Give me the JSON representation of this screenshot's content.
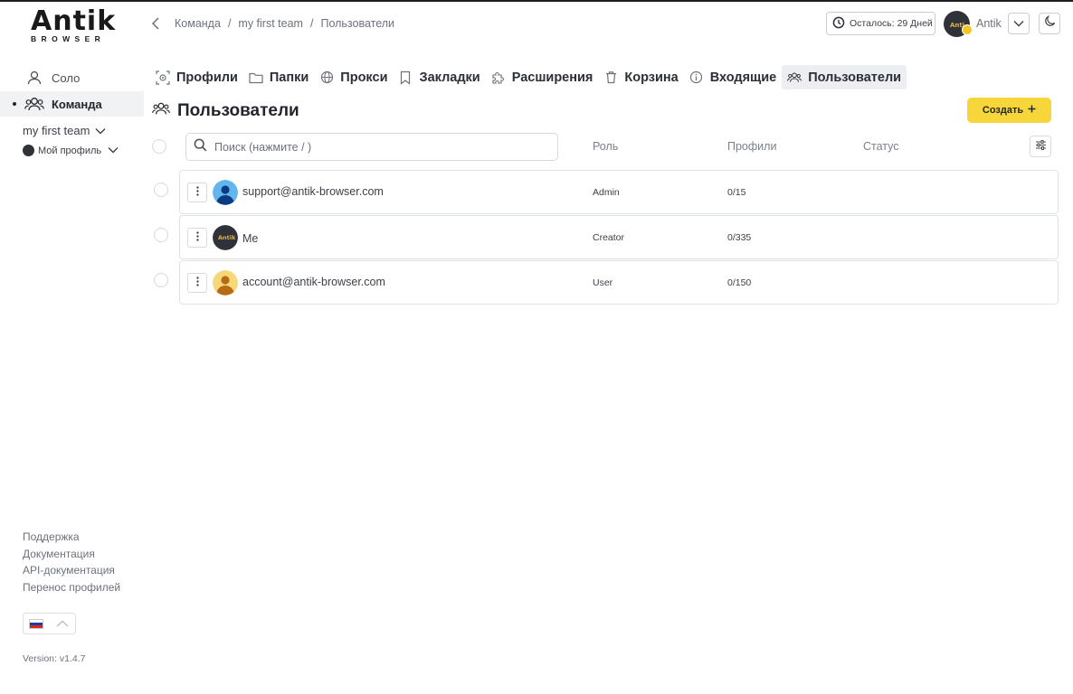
{
  "brand": {
    "name": "Antik",
    "sub": "BROWSER"
  },
  "sidebar": {
    "items": [
      {
        "label": "Соло",
        "icon": "user-icon"
      },
      {
        "label": "Команда",
        "icon": "team-icon"
      }
    ],
    "team_select": "my first team",
    "profile_select": "Мой профиль",
    "footer_links": [
      "Поддержка",
      "Документация",
      "API-документация",
      "Перенос профилей"
    ],
    "language": "ru",
    "version": "Version: v1.4.7"
  },
  "header": {
    "breadcrumb": [
      "Команда",
      "my first team",
      "Пользователи"
    ],
    "separator": "/",
    "remaining": "Осталось: 29 Дней",
    "user_name": "Antik"
  },
  "tabs": [
    {
      "label": "Профили",
      "icon": "fingerprint-icon",
      "active": false
    },
    {
      "label": "Папки",
      "icon": "folder-icon",
      "active": false
    },
    {
      "label": "Прокси",
      "icon": "globe-icon",
      "active": false
    },
    {
      "label": "Закладки",
      "icon": "bookmark-icon",
      "active": false
    },
    {
      "label": "Расширения",
      "icon": "puzzle-icon",
      "active": false
    },
    {
      "label": "Корзина",
      "icon": "trash-icon",
      "active": false
    },
    {
      "label": "Входящие",
      "icon": "info-icon",
      "active": false
    },
    {
      "label": "Пользователи",
      "icon": "users-icon",
      "active": true
    }
  ],
  "page": {
    "title": "Пользователи",
    "create_label": "Создать",
    "search_placeholder": "Поиск (нажмите / )",
    "columns": {
      "role": "Роль",
      "profiles": "Профили",
      "status": "Статус"
    }
  },
  "users": [
    {
      "email": "support@antik-browser.com",
      "role": "Admin",
      "profiles": "0/15",
      "avatar": "blue-person-avatar"
    },
    {
      "email": "Me",
      "role": "Creator",
      "profiles": "0/335",
      "avatar": "antik-logo-avatar"
    },
    {
      "email": "account@antik-browser.com",
      "role": "User",
      "profiles": "0/150",
      "avatar": "yellow-person-avatar"
    }
  ],
  "colors": {
    "accent": "#f7d63c",
    "active_bg": "#eceef1",
    "text": "#2b2f36",
    "muted": "#6c727c"
  }
}
